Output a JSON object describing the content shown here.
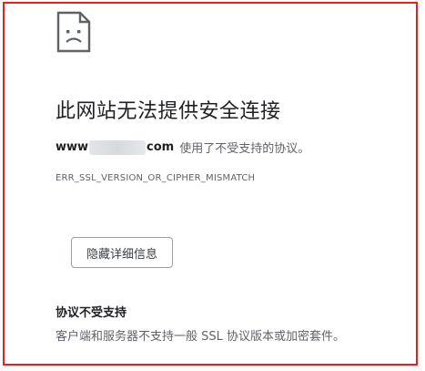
{
  "error_page": {
    "title": "此网站无法提供安全连接",
    "domain_prefix": "www",
    "domain_suffix": "com",
    "message": "使用了不受支持的协议。",
    "error_code": "ERR_SSL_VERSION_OR_CIPHER_MISMATCH",
    "details_button": "隐藏详细信息",
    "details": {
      "heading": "协议不受支持",
      "text": "客户端和服务器不支持一般 SSL 协议版本或加密套件。"
    }
  },
  "colors": {
    "frame_border": "#e8211a",
    "title": "#202124",
    "body_text": "#5f6368"
  },
  "icons": {
    "error_icon": "sad-document-icon"
  }
}
